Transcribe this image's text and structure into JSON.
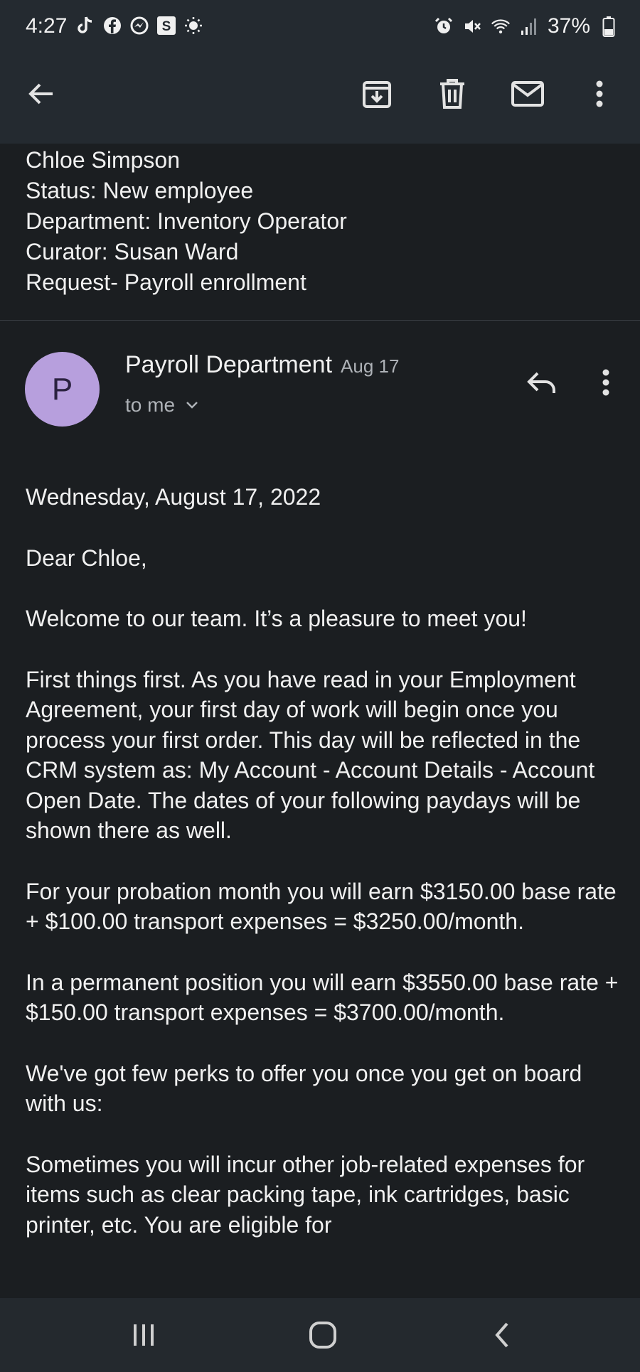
{
  "status_bar": {
    "time": "4:27",
    "battery": "37%",
    "icons_left": [
      "tiktok-icon",
      "facebook-icon",
      "messenger-icon",
      "s-app-icon",
      "brightness-icon"
    ],
    "icons_right": [
      "alarm-icon",
      "mute-icon",
      "wifi-icon",
      "signal-icon",
      "battery-icon"
    ]
  },
  "toolbar": {
    "actions": [
      "back",
      "archive",
      "delete",
      "mark-unread",
      "more"
    ]
  },
  "previous_message": {
    "lines": [
      "Chloe Simpson",
      "Status: New employee",
      "Department: Inventory Operator",
      "Curator: Susan Ward",
      "Request- Payroll enrollment"
    ]
  },
  "message": {
    "avatar_letter": "P",
    "avatar_color": "#b79fdd",
    "sender": "Payroll Department",
    "date": "Aug 17",
    "recipient": "to me",
    "body": [
      "Wednesday, August 17, 2022",
      "Dear Chloe,",
      "Welcome to our team. It’s a pleasure to meet you!",
      "First things first. As you have read in your Employment Agreement, your first day of work will begin once you process your first order. This day will be reflected in the CRM system as: My Account - Account Details - Account Open Date. The dates of your following paydays will be shown there as well.",
      "For your probation month you will earn $3150.00 base rate + $100.00 transport expenses = $3250.00/month.",
      "In a permanent position you will earn $3550.00 base rate + $150.00 transport expenses = $3700.00/month.",
      "We've got few perks to offer you once you get on board with us:",
      "Sometimes you will incur other job-related expenses for items such as clear packing tape, ink cartridges, basic printer, etc. You are eligible for"
    ]
  },
  "colors": {
    "background": "#1b1e21",
    "top_bar": "#242a30",
    "nav_bar": "#24292e",
    "text": "#f0f0f0",
    "muted_text": "#aeb2b7"
  }
}
